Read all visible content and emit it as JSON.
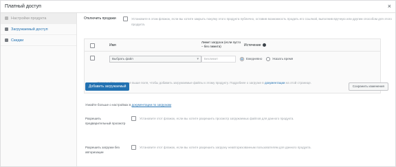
{
  "dialog": {
    "title": "Платный доступ",
    "close_glyph": "×"
  },
  "sidebar": {
    "items": [
      {
        "label": "Настройки продукта",
        "active": true
      },
      {
        "label": "Загружаемый доступ",
        "active": false
      },
      {
        "label": "Скидки",
        "active": false
      }
    ]
  },
  "sales": {
    "label": "Отключить продажи",
    "description": "Установите в этом флажок, если вы хотите закрыть покупку этого продукта публично, оставив возможность продать его ссылкой, выполнив вручную или другим способом для этого продукта."
  },
  "downloads": {
    "headers": {
      "name": "Имя",
      "limit": "Лимит загрузок (если пусто – без лимита)",
      "expiry": "Истечение"
    },
    "row": {
      "file_select": "Выбрать файл",
      "limit_placeholder": "Безлимит",
      "option_a": "Ежедневно",
      "option_b": "Указать время"
    },
    "note": "Используйте указанные выше поля, чтобы добавить загружаемые файлы к этому продукту. Подробнее о загрузке в ",
    "note_link": "документации",
    "note_tail": " на этой странице."
  },
  "buttons": {
    "add_download": "Добавить загружаемый",
    "save_changes": "Сохранить изменения"
  },
  "footnote": {
    "text": "Узнайте больше о настройках в ",
    "link": "документации по загрузкам"
  },
  "options": [
    {
      "label": "Разрешить предварительный просмотр",
      "text": "Установите этот флажок, если вы хотите разрешить просмотр загружаемых файлов для данного продукта."
    },
    {
      "label": "Разрешить загрузки без авторизации",
      "text": "Установите этот флажок, если вы хотите разрешить загрузку неавторизованным пользователям для данного продукта."
    }
  ],
  "colors": {
    "accent": "#2271b1",
    "text": "#50575e"
  }
}
